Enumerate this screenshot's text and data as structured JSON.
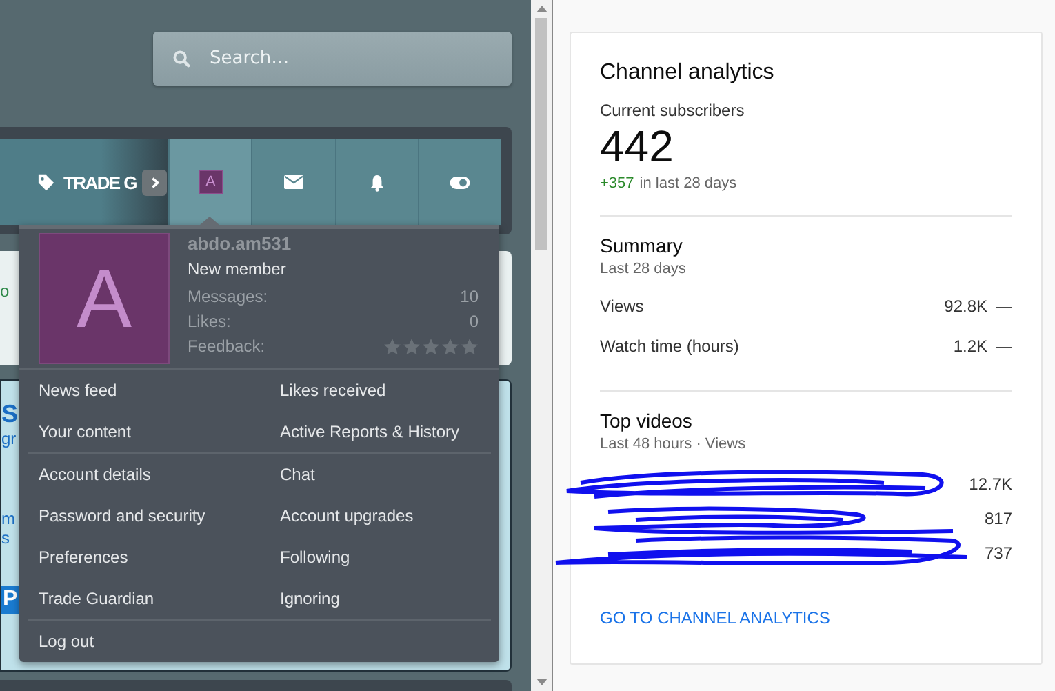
{
  "search": {
    "placeholder": "Search…"
  },
  "nav": {
    "label_tab": {
      "label": "TRADE G",
      "selected": false
    },
    "tabs": [
      {
        "kind": "avatar",
        "letter": "A",
        "selected": true
      },
      {
        "kind": "mail",
        "selected": false
      },
      {
        "kind": "bell",
        "selected": false
      },
      {
        "kind": "toggle",
        "selected": false
      }
    ]
  },
  "page_fragments": [
    {
      "kind": "card",
      "lines": [
        {
          "text": "o",
          "kind": "plain"
        }
      ]
    },
    {
      "kind": "panel",
      "lines": [
        {
          "text": "S",
          "kind": "heading"
        },
        {
          "text": "gr",
          "kind": "link"
        },
        {
          "text": "m",
          "kind": "link"
        },
        {
          "text": "s",
          "kind": "link"
        },
        {
          "text": "P",
          "kind": "button"
        }
      ]
    }
  ],
  "account_menu": {
    "avatar_letter": "A",
    "username": "abdo.am531",
    "user_title": "New member",
    "stats": [
      {
        "kind": "count",
        "label": "Messages:",
        "value": "10"
      },
      {
        "kind": "count",
        "label": "Likes:",
        "value": "0"
      },
      {
        "kind": "rating",
        "label": "Feedback:",
        "stars": 0
      }
    ],
    "sections": [
      [
        "News feed",
        "Likes received",
        "Your content",
        "Active Reports & History"
      ],
      [
        "Account details",
        "Chat",
        "Password and security",
        "Account upgrades",
        "Preferences",
        "Following",
        "Trade Guardian",
        "Ignoring"
      ],
      [
        "Log out"
      ]
    ]
  },
  "analytics": {
    "title": "Channel analytics",
    "subscribers_label": "Current subscribers",
    "subscribers": "442",
    "change": "+357",
    "change_period": "in last 28 days",
    "summary": {
      "title": "Summary",
      "period": "Last 28 days",
      "rows": [
        {
          "label": "Views",
          "value": "92.8K",
          "trend": "—"
        },
        {
          "label": "Watch time (hours)",
          "value": "1.2K",
          "trend": "—"
        }
      ]
    },
    "top_videos": {
      "title": "Top videos",
      "period": "Last 48 hours · Views",
      "rows": [
        {
          "value": "12.7K"
        },
        {
          "value": "817"
        },
        {
          "value": "737"
        }
      ]
    },
    "link": "GO TO CHANNEL ANALYTICS"
  }
}
